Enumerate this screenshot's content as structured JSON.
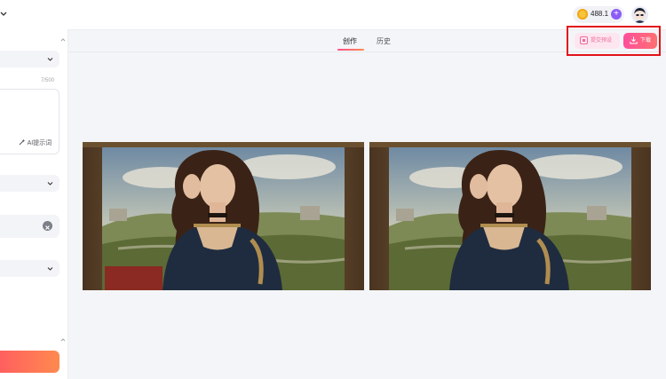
{
  "header": {
    "credits": "488.1",
    "plus_icon": "+"
  },
  "left_panel": {
    "char_counter": "7/500",
    "ai_hint_label": "AI提示词"
  },
  "tabs": [
    {
      "label": "创作",
      "active": true
    },
    {
      "label": "历史",
      "active": false
    }
  ],
  "actions": {
    "pro_label": "提交预设",
    "download_label": "下载"
  },
  "results": [
    {
      "name": "generated-image-1"
    },
    {
      "name": "generated-image-2"
    }
  ],
  "colors": {
    "accent_pink": "#ff4f9b",
    "accent_orange": "#ff8a4f",
    "highlight_red": "#e2121a"
  }
}
